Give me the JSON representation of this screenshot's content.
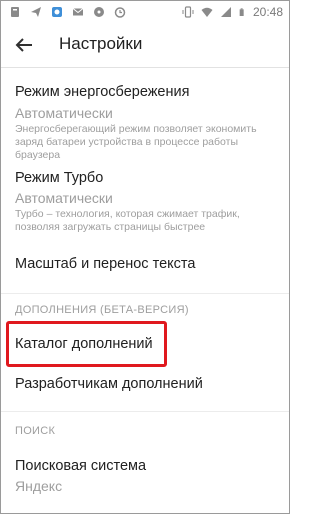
{
  "status_bar": {
    "time": "20:48",
    "left_icons": [
      "notification-icon",
      "send-icon",
      "photo-icon",
      "mail-icon",
      "media-icon",
      "alarm-icon"
    ],
    "right_icons": [
      "vibrate-icon",
      "wifi-icon",
      "signal-icon",
      "battery-icon"
    ]
  },
  "toolbar": {
    "title": "Настройки"
  },
  "settings": {
    "energy": {
      "title": "Режим энергосбережения",
      "value": "Автоматически",
      "description": "Энергосберегающий режим позволяет экономить заряд батареи устройства в процессе работы браузера"
    },
    "turbo": {
      "title": "Режим Турбо",
      "value": "Автоматически",
      "description": "Турбо – технология, которая сжимает трафик, позволяя загружать страницы быстрее"
    },
    "text_scale": {
      "title": "Масштаб и перенос текста"
    }
  },
  "addons": {
    "header": "ДОПОЛНЕНИЯ (БЕТА-ВЕРСИЯ)",
    "catalog": "Каталог дополнений",
    "developers": "Разработчикам дополнений"
  },
  "search": {
    "header": "ПОИСК",
    "engine_title": "Поисковая система",
    "engine_value": "Яндекс"
  },
  "colors": {
    "highlight": "#e0181e",
    "secondary_text": "#9e9e9e",
    "primary_text": "#212121"
  }
}
